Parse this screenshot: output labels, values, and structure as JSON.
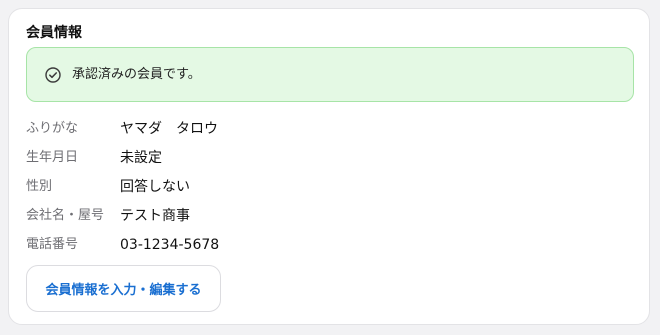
{
  "card": {
    "title": "会員情報"
  },
  "alert": {
    "icon": "check-circle-icon",
    "text": "承認済みの会員です。",
    "colors": {
      "background": "#e4f9e4",
      "border": "#a7e4a7",
      "icon": "#3a3a3a"
    }
  },
  "info": {
    "rows": [
      {
        "label": "ふりがな",
        "value": "ヤマダ　タロウ"
      },
      {
        "label": "生年月日",
        "value": "未設定"
      },
      {
        "label": "性別",
        "value": "回答しない"
      },
      {
        "label": "会社名・屋号",
        "value": "テスト商事"
      },
      {
        "label": "電話番号",
        "value": "03-1234-5678"
      }
    ]
  },
  "actions": {
    "edit_label": "会員情報を入力・編集する",
    "accent": "#1a6fd1"
  }
}
